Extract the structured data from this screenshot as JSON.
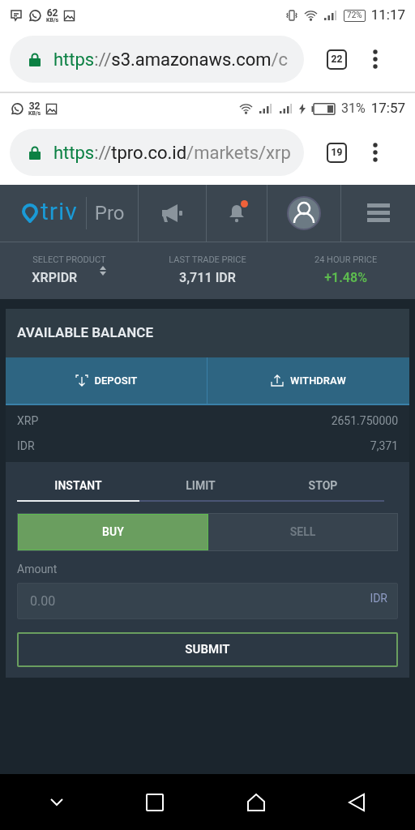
{
  "screens": [
    {
      "status_bar": {
        "left_items": [
          {
            "kind": "message"
          },
          {
            "kind": "whatsapp"
          },
          {
            "kind": "speed",
            "value": "62",
            "unit": "KB/s"
          },
          {
            "kind": "image"
          }
        ],
        "right_items": [
          {
            "kind": "vibrate"
          },
          {
            "kind": "wifi"
          },
          {
            "kind": "signal"
          },
          {
            "kind": "battery",
            "text": "72%"
          }
        ],
        "time": "11:17"
      },
      "address_bar": {
        "scheme": "https",
        "separator": "://",
        "host": "s3.amazonaws.com",
        "path": "/c",
        "tab_count": "22"
      }
    },
    {
      "status_bar": {
        "left_items": [
          {
            "kind": "whatsapp"
          },
          {
            "kind": "speed",
            "value": "32",
            "unit": "KB/s"
          },
          {
            "kind": "image"
          }
        ],
        "right_items": [
          {
            "kind": "wifi"
          },
          {
            "kind": "signal"
          },
          {
            "kind": "signal"
          },
          {
            "kind": "charging"
          },
          {
            "kind": "battery"
          },
          {
            "kind": "percent",
            "text": "31%"
          }
        ],
        "time": "17:57"
      },
      "address_bar": {
        "scheme": "https",
        "separator": "://",
        "host": "tpro.co.id",
        "path": "/markets/xrp",
        "tab_count": "19"
      }
    }
  ],
  "app": {
    "logo": {
      "brand": "triv",
      "suffix": "Pro"
    },
    "nav": {
      "notification_dot": true
    },
    "ticker": [
      {
        "label": "SELECT PRODUCT",
        "value": "XRPIDR",
        "kind": "select"
      },
      {
        "label": "LAST TRADE PRICE",
        "value": "3,711 IDR",
        "kind": "plain"
      },
      {
        "label": "24 HOUR PRICE",
        "value": "+1.48%",
        "kind": "up"
      }
    ],
    "balance": {
      "title": "AVAILABLE BALANCE",
      "actions": [
        {
          "label": "DEPOSIT",
          "kind": "deposit"
        },
        {
          "label": "WITHDRAW",
          "kind": "withdraw"
        }
      ],
      "rows": [
        {
          "asset": "XRP",
          "amount": "2651.750000"
        },
        {
          "asset": "IDR",
          "amount": "7,371"
        }
      ]
    },
    "order": {
      "tabs": [
        {
          "label": "INSTANT",
          "selected": true
        },
        {
          "label": "LIMIT",
          "selected": false
        },
        {
          "label": "STOP",
          "selected": false
        }
      ],
      "sides": [
        {
          "label": "BUY",
          "selected": true
        },
        {
          "label": "SELL",
          "selected": false
        }
      ],
      "amount": {
        "label": "Amount",
        "placeholder": "0.00",
        "unit": "IDR"
      },
      "submit": "SUBMIT"
    }
  }
}
